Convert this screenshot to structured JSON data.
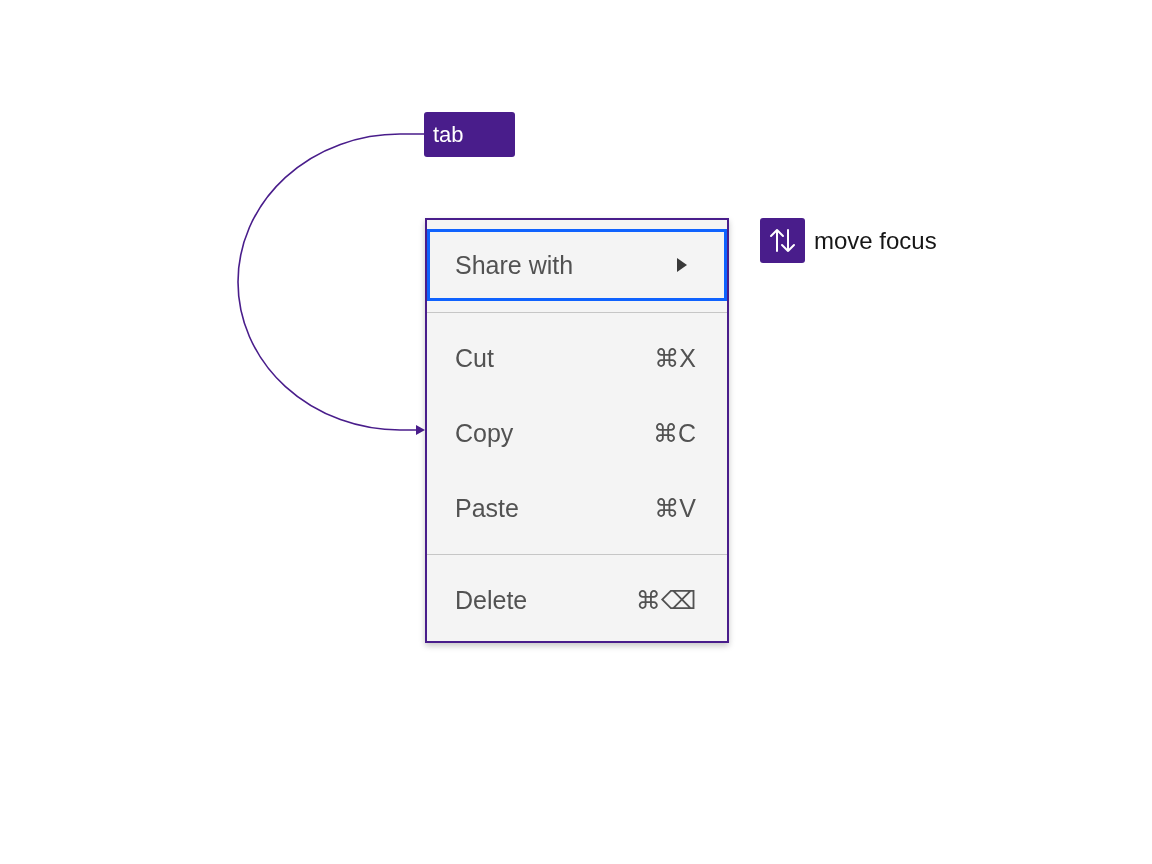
{
  "annotations": [
    {
      "kind": "key",
      "label": "tab"
    },
    {
      "kind": "legend",
      "label": "move focus"
    }
  ],
  "menu": {
    "groups": [
      {
        "items": [
          {
            "label": "Share with",
            "submenu": true,
            "focused": true
          }
        ]
      },
      {
        "items": [
          {
            "label": "Cut",
            "shortcut": "⌘X",
            "submenu": false,
            "focused": false
          },
          {
            "label": "Copy",
            "shortcut": "⌘C",
            "submenu": false,
            "focused": false
          },
          {
            "label": "Paste",
            "shortcut": "⌘V",
            "submenu": false,
            "focused": false
          }
        ]
      },
      {
        "items": [
          {
            "label": "Delete",
            "shortcut": "⌘⌫",
            "submenu": false,
            "focused": false
          }
        ]
      }
    ]
  }
}
